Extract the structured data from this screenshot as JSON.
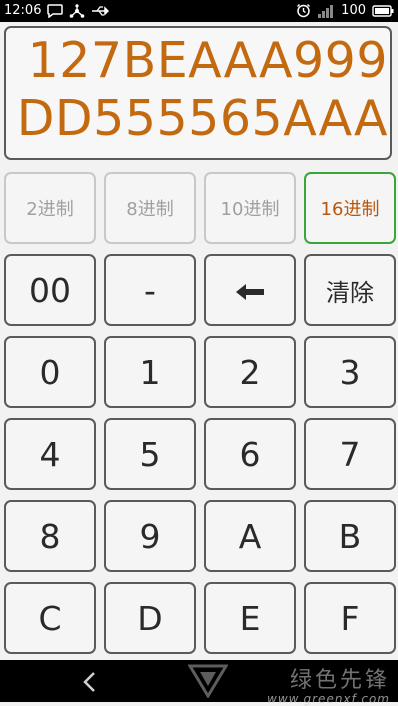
{
  "status_bar": {
    "time": "12:06",
    "battery_level": "100"
  },
  "display": {
    "value": "127BEAAA999DD555565AAA"
  },
  "base_buttons": [
    {
      "label": "2进制",
      "selected": false
    },
    {
      "label": "8进制",
      "selected": false
    },
    {
      "label": "10进制",
      "selected": false
    },
    {
      "label": "16进制",
      "selected": true
    }
  ],
  "keypad": {
    "rows": [
      [
        "00",
        "-",
        "",
        "清除"
      ],
      [
        "0",
        "1",
        "2",
        "3"
      ],
      [
        "4",
        "5",
        "6",
        "7"
      ],
      [
        "8",
        "9",
        "A",
        "B"
      ],
      [
        "C",
        "D",
        "E",
        "F"
      ]
    ],
    "backspace_icon": "left-arrow-icon"
  },
  "watermark": {
    "title": "绿色先锋",
    "url": "www.greenxf.com"
  },
  "colors": {
    "display_text": "#c36a10",
    "selected_border": "#3aa53a",
    "selected_text": "#b8570f"
  }
}
